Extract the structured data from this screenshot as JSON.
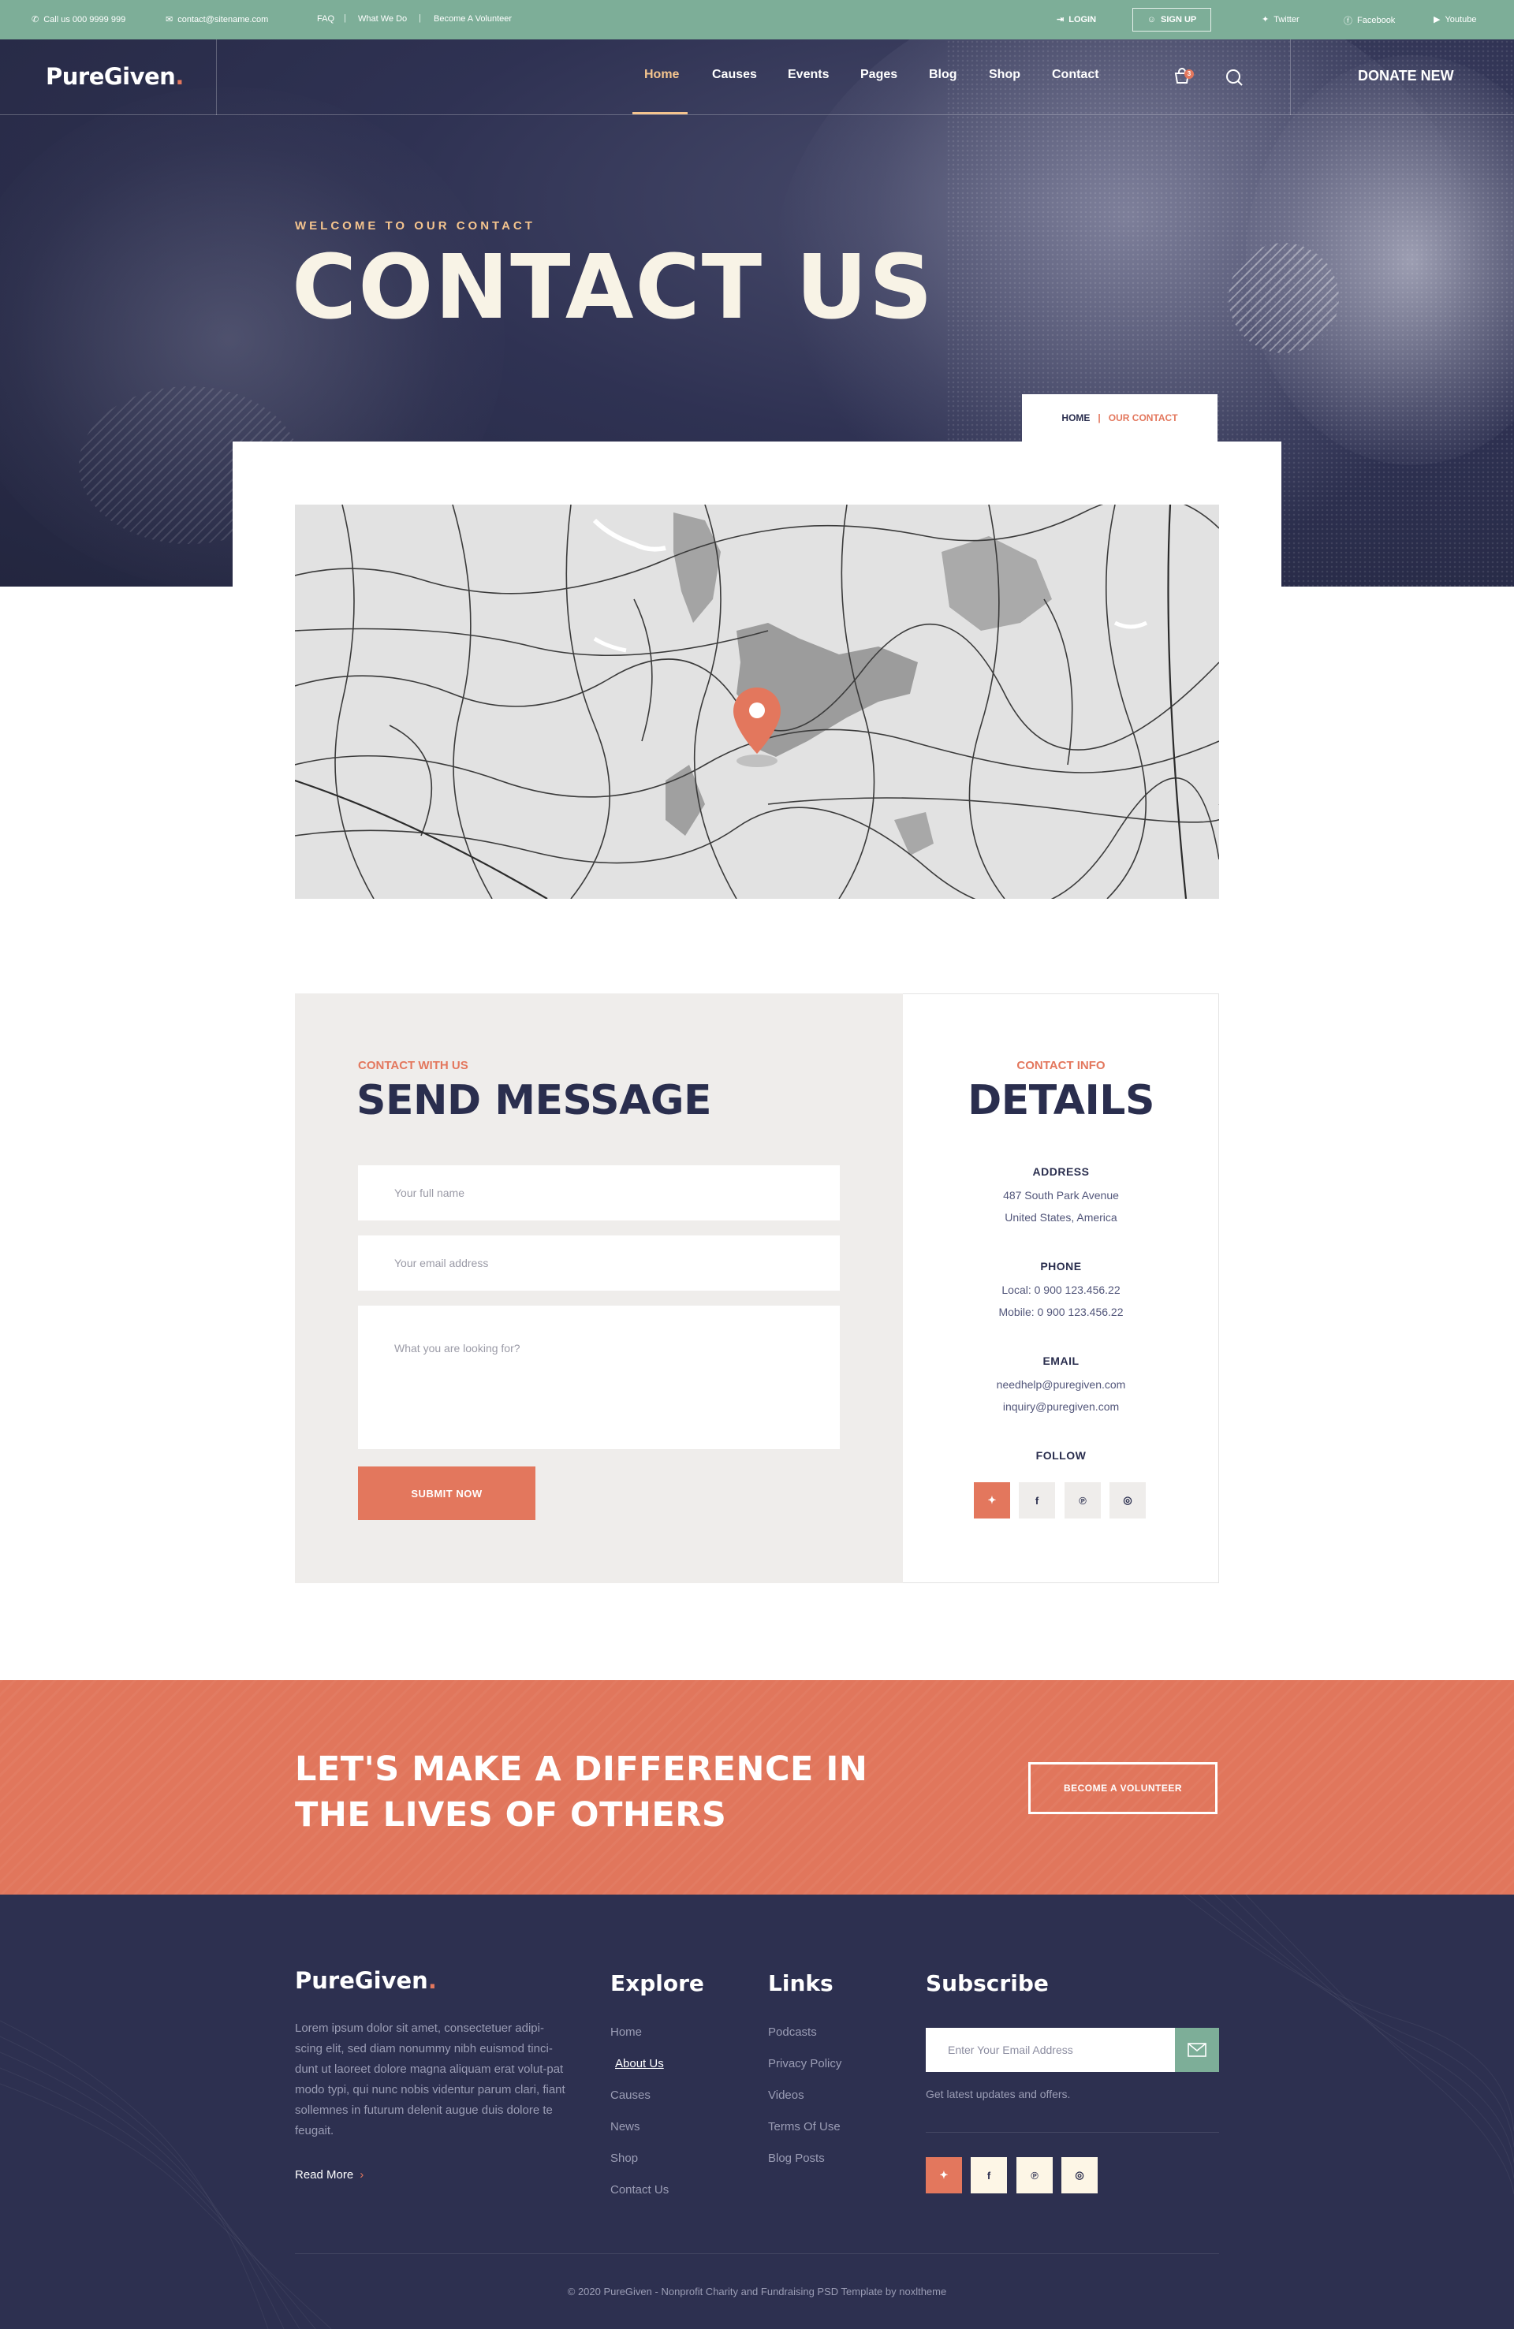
{
  "topbar": {
    "phone": "Call us 000 9999 999",
    "email": "contact@sitename.com",
    "links": [
      "FAQ",
      "What We Do",
      "Become A Volunteer"
    ],
    "login": "LOGIN",
    "signup": "SIGN UP",
    "social": [
      "Twitter",
      "Facebook",
      "Youtube"
    ]
  },
  "nav": {
    "logo": "PureGiven",
    "logo_dot": ".",
    "items": [
      "Home",
      "Causes",
      "Events",
      "Pages",
      "Blog",
      "Shop",
      "Contact"
    ],
    "active": "Home",
    "cart_count": "3",
    "donate": "DONATE NEW"
  },
  "hero": {
    "subtitle": "WELCOME TO OUR CONTACT",
    "title": "CONTACT US"
  },
  "breadcrumb": {
    "home": "HOME",
    "sep": "|",
    "current": "OUR CONTACT"
  },
  "form": {
    "eyebrow": "CONTACT WITH US",
    "title": "SEND MESSAGE",
    "name_placeholder": "Your full name",
    "email_placeholder": "Your email address",
    "message_placeholder": "What you are looking for?",
    "submit": "SUBMIT NOW"
  },
  "details": {
    "eyebrow": "CONTACT INFO",
    "title": "DETAILS",
    "address_label": "ADDRESS",
    "address_line1": "487 South Park Avenue",
    "address_line2": "United States, America",
    "phone_label": "PHONE",
    "phone_local": "Local: 0 900 123.456.22",
    "phone_mobile": "Mobile: 0 900 123.456.22",
    "email_label": "EMAIL",
    "email1": "needhelp@puregiven.com",
    "email2": "inquiry@puregiven.com",
    "follow_label": "FOLLOW"
  },
  "cta": {
    "line1": "LET'S MAKE A DIFFERENCE IN",
    "line2": "THE LIVES OF OTHERS",
    "button": "BECOME A VOLUNTEER"
  },
  "footer": {
    "logo": "PureGiven",
    "logo_dot": ".",
    "about": "Lorem ipsum dolor sit amet, consectetuer adipi-scing elit, sed diam nonummy nibh euismod tinci-dunt ut laoreet dolore magna aliquam erat volut-pat modo typi, qui nunc nobis videntur parum clari, fiant sollemnes in futurum delenit augue duis dolore te feugait.",
    "read_more": "Read More",
    "explore_title": "Explore",
    "explore": [
      "Home",
      "About Us",
      "Causes",
      "News",
      "Shop",
      "Contact Us"
    ],
    "links_title": "Links",
    "links": [
      "Podcasts",
      "Privacy Policy",
      "Videos",
      "Terms Of Use",
      "Blog Posts"
    ],
    "subscribe_title": "Subscribe",
    "subscribe_placeholder": "Enter Your Email Address",
    "subscribe_note": "Get latest updates and offers.",
    "copyright": "© 2020 PureGiven - Nonprofit Charity and Fundraising PSD Template by noxltheme"
  },
  "colors": {
    "accent": "#e3775d",
    "green": "#7dae98",
    "navy": "#2d3050",
    "gold": "#f4c48e"
  }
}
